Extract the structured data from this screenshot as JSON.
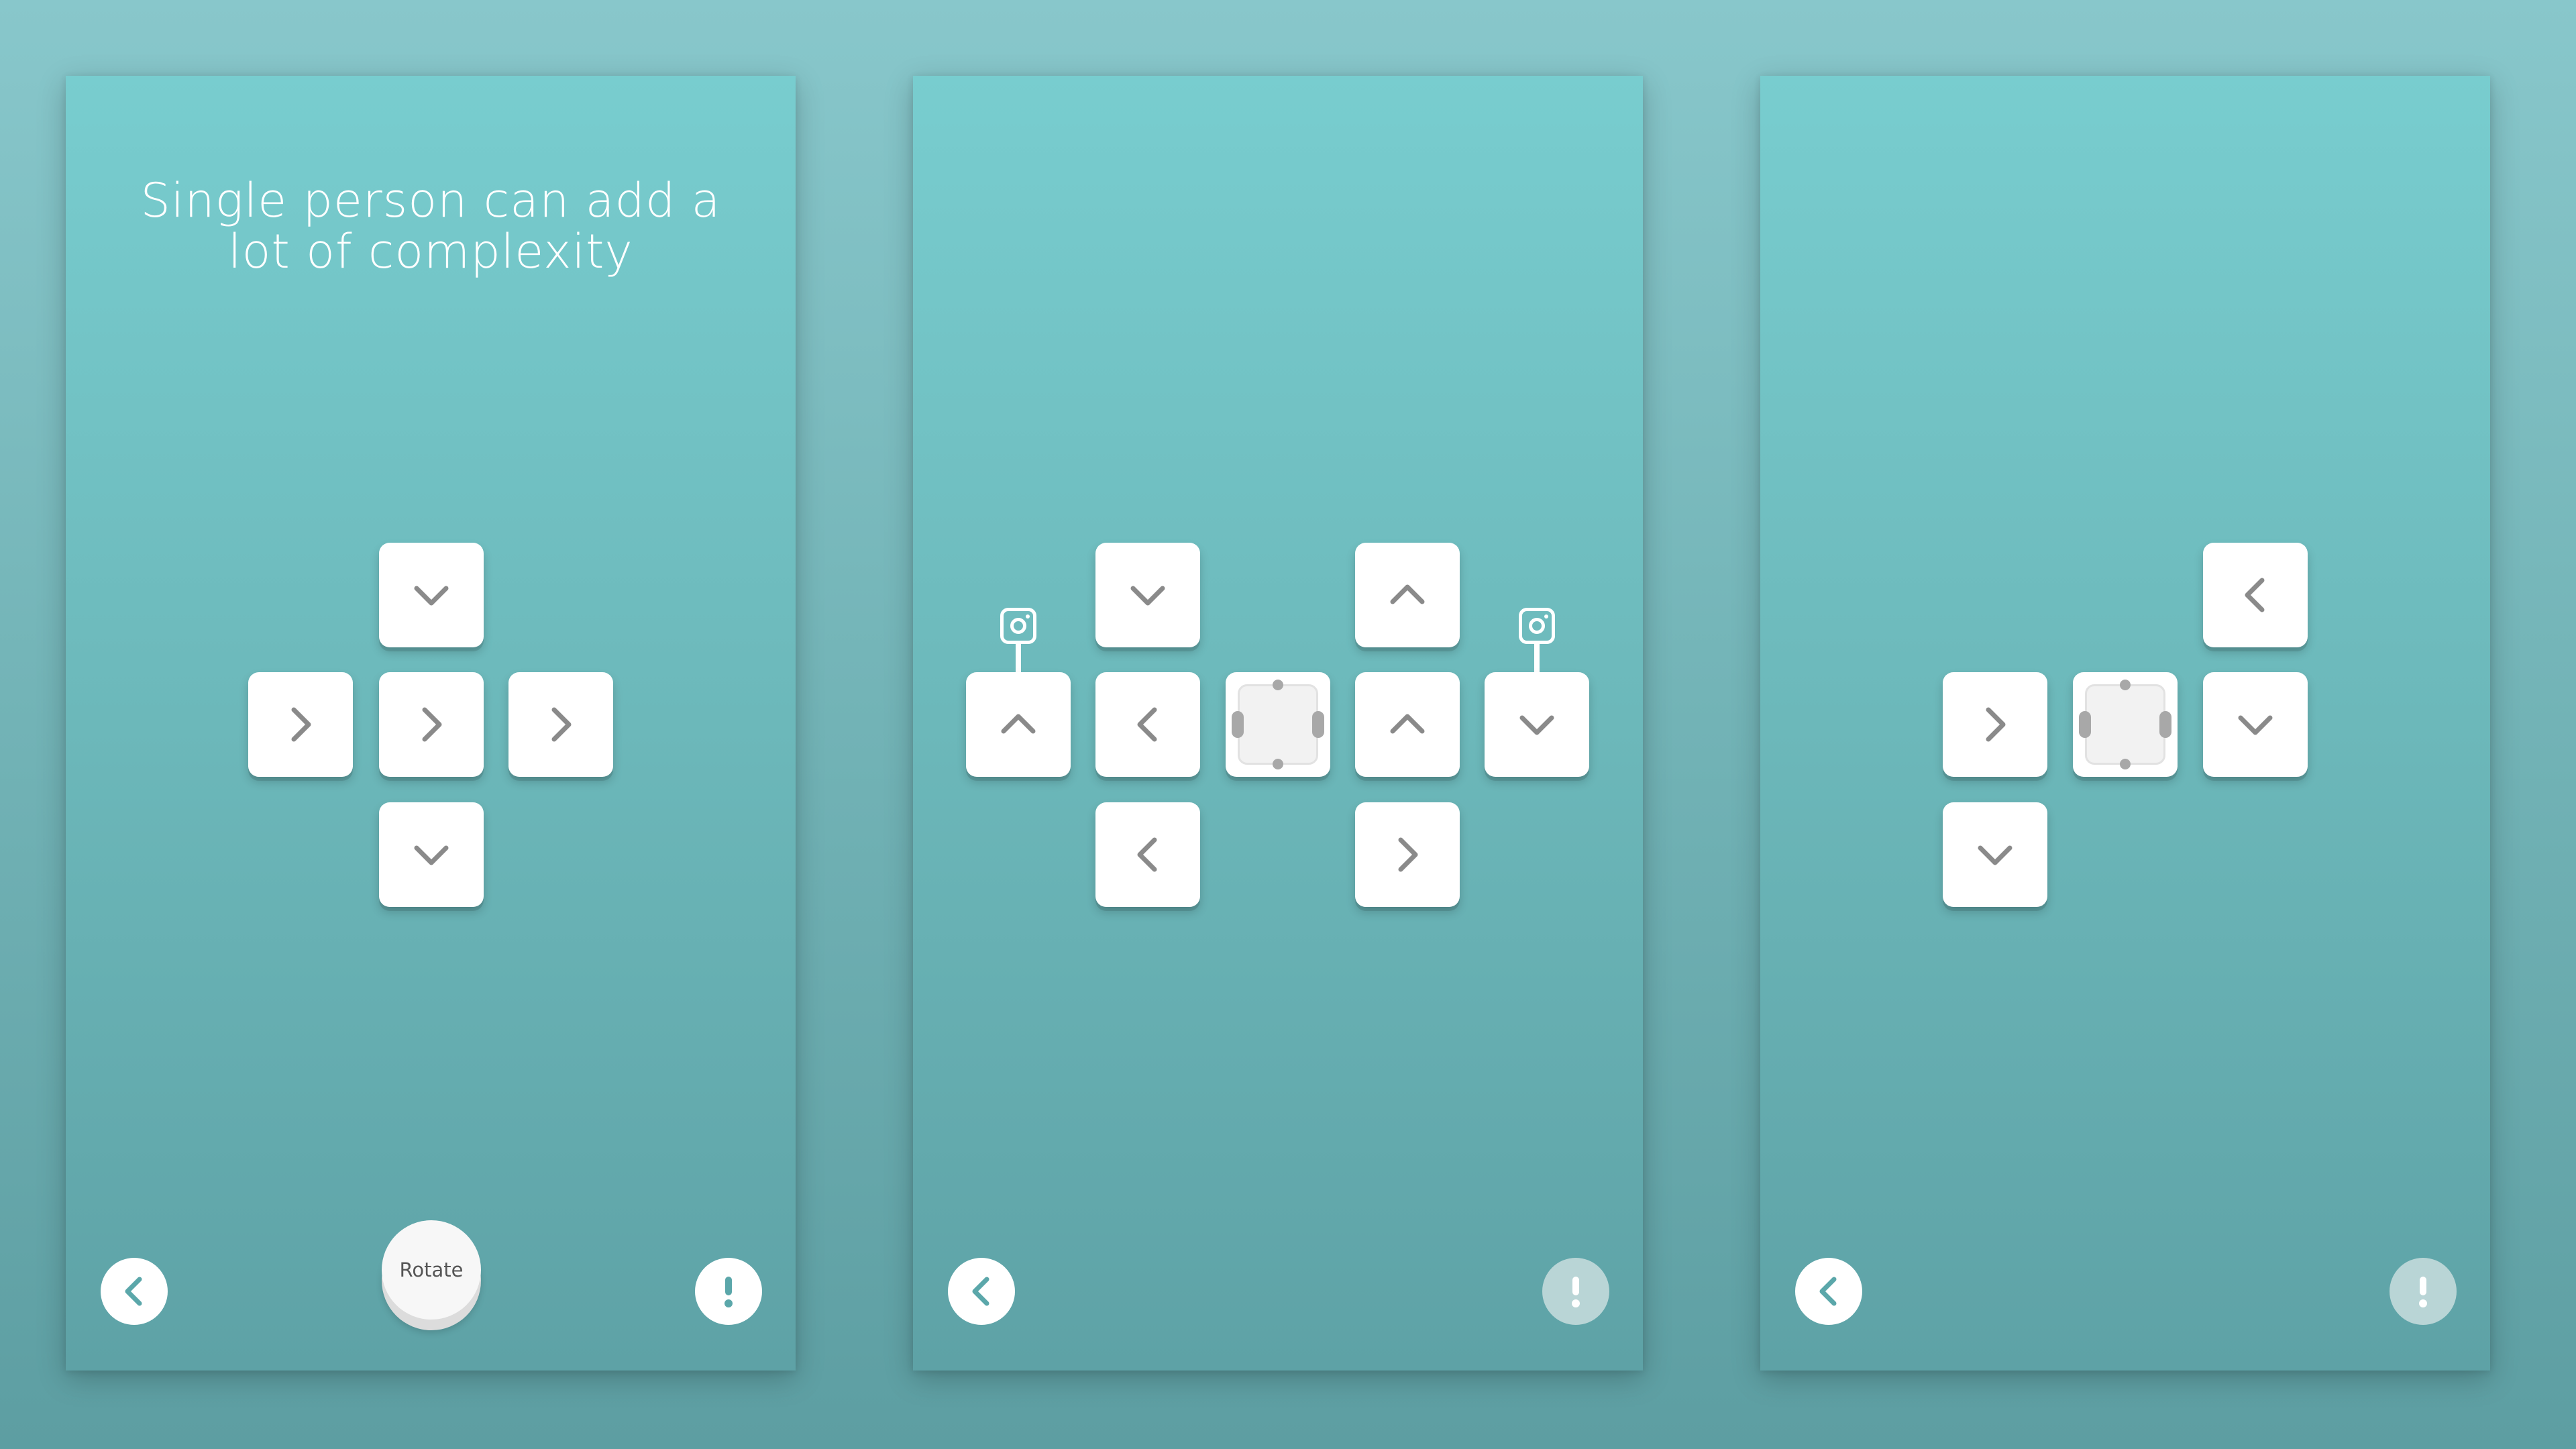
{
  "colors": {
    "arrow": "#8a8a8a",
    "back_icon": "#5ba7aa",
    "info_icon": "#5ba7aa",
    "info_icon_disabled": "#ffffff"
  },
  "screens": [
    {
      "title": "Single person can add a lot of complexity",
      "rotate_label": "Rotate",
      "tiles": [
        "down",
        "right",
        "right",
        "right",
        "down"
      ],
      "back_icon": "chevron-left-icon",
      "info_icon": "exclamation-icon",
      "info_enabled": true
    },
    {
      "tiles": [
        "up",
        "down",
        "left",
        "left",
        "hub",
        "up",
        "up",
        "right",
        "down"
      ],
      "cameras": 2,
      "back_icon": "chevron-left-icon",
      "info_icon": "exclamation-icon",
      "info_enabled": false
    },
    {
      "tiles": [
        "left",
        "right",
        "hub",
        "down",
        "down"
      ],
      "back_icon": "chevron-left-icon",
      "info_icon": "exclamation-icon",
      "info_enabled": false
    }
  ]
}
